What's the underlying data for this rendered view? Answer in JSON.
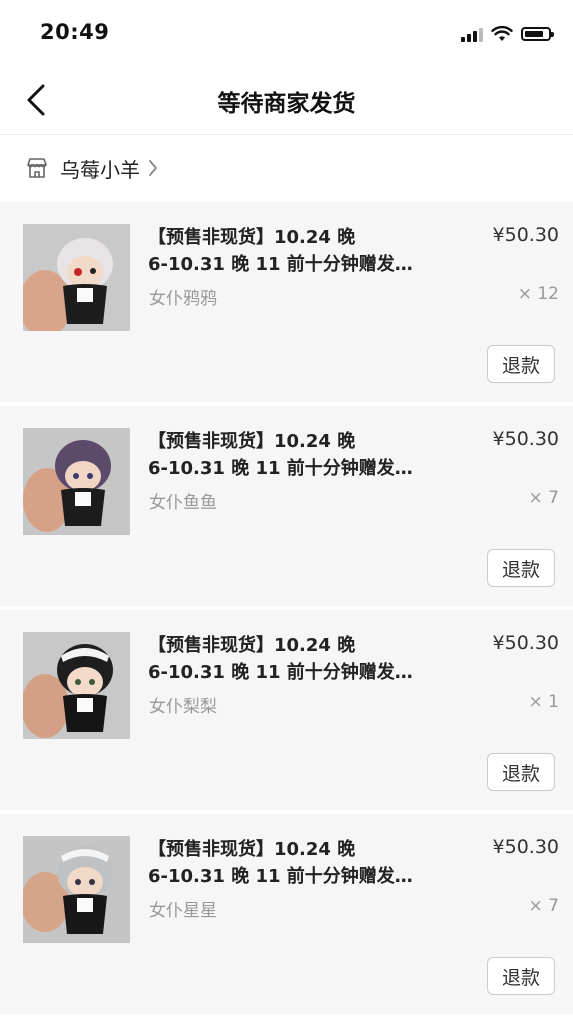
{
  "status_bar": {
    "time": "20:49"
  },
  "nav": {
    "title": "等待商家发货"
  },
  "shop": {
    "name": "乌莓小羊"
  },
  "items": [
    {
      "title": "【预售非现货】10.24 晚\n6-10.31 晚 11 前十分钟赠发…",
      "variant": "女仆鸦鸦",
      "price": "¥50.30",
      "qty": "× 12",
      "refund_label": "退款"
    },
    {
      "title": "【预售非现货】10.24 晚\n6-10.31 晚 11 前十分钟赠发…",
      "variant": "女仆鱼鱼",
      "price": "¥50.30",
      "qty": "× 7",
      "refund_label": "退款"
    },
    {
      "title": "【预售非现货】10.24 晚\n6-10.31 晚 11 前十分钟赠发…",
      "variant": "女仆梨梨",
      "price": "¥50.30",
      "qty": "× 1",
      "refund_label": "退款"
    },
    {
      "title": "【预售非现货】10.24 晚\n6-10.31 晚 11 前十分钟赠发…",
      "variant": "女仆星星",
      "price": "¥50.30",
      "qty": "× 7",
      "refund_label": "退款"
    }
  ],
  "icons": {
    "back": "chevron-left-icon",
    "shop": "store-icon",
    "shop_chevron": "chevron-right-icon",
    "signal": "cellular-signal-icon",
    "wifi": "wifi-icon",
    "battery": "battery-icon"
  }
}
